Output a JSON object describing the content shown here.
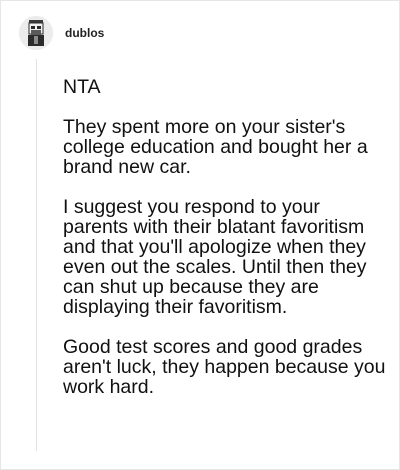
{
  "comment": {
    "username": "dublos",
    "paragraphs": [
      "NTA",
      "They spent more on your sister's college education and bought her a brand new car.",
      "I suggest you respond to your parents with their blatant favoritism and that you'll apologize when they even out the scales. Until then they can shut up because they are displaying their favoritism.",
      "Good test scores and good grades aren't luck, they happen because you work hard."
    ]
  }
}
